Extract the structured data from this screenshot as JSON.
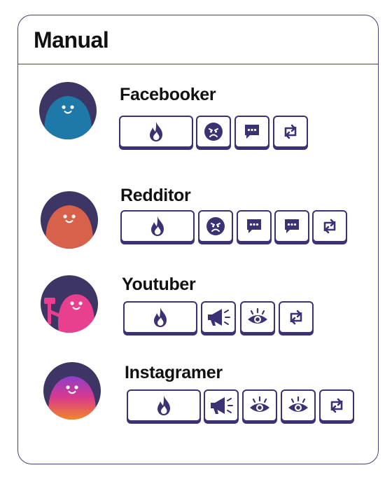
{
  "manual": {
    "title": "Manual"
  },
  "colors": {
    "outline": "#3b3273",
    "avatar_bg": "#3d3563"
  },
  "users": [
    {
      "name": "Facebooker",
      "avatar": "blue-blob-avatar",
      "actions": [
        "fire-icon",
        "angry-face-icon",
        "chat-bubble-icon",
        "repost-icon"
      ]
    },
    {
      "name": "Redditor",
      "avatar": "red-blob-avatar",
      "actions": [
        "fire-icon",
        "angry-face-icon",
        "chat-bubble-icon",
        "chat-bubble-icon",
        "repost-icon"
      ]
    },
    {
      "name": "Youtuber",
      "avatar": "pink-blob-avatar",
      "actions": [
        "fire-icon",
        "megaphone-icon",
        "eye-icon",
        "repost-icon"
      ]
    },
    {
      "name": "Instagramer",
      "avatar": "gradient-blob-avatar",
      "actions": [
        "fire-icon",
        "megaphone-icon",
        "eye-icon",
        "eye-icon",
        "repost-icon"
      ]
    }
  ]
}
